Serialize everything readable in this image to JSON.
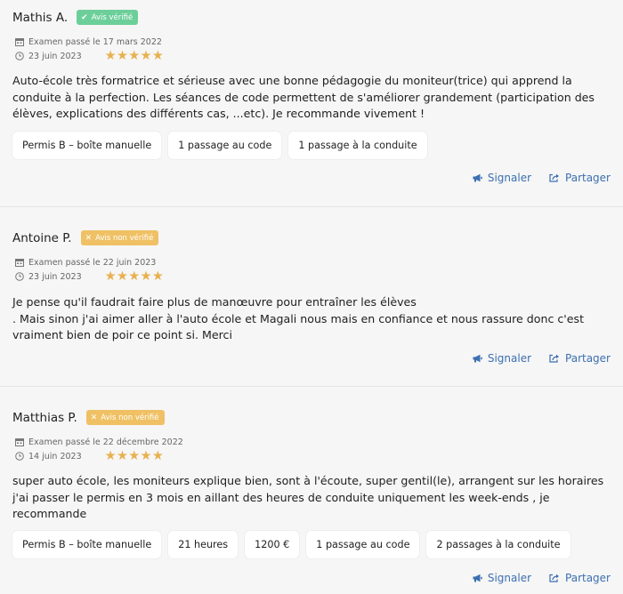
{
  "reviews": [
    {
      "name": "Mathis A.",
      "badge": "Avis vérifié",
      "badge_icon": "check-icon",
      "exam": "Examen passé le 17 mars 2022",
      "date": "23 juin 2023",
      "stars": "★★★★★",
      "rating": 5,
      "text": "Auto-école très formatrice et sérieuse avec une bonne pédagogie du moniteur(trice) qui apprend la conduite à la perfection. Les séances de code permettent de s'améliorer grandement (participation des élèves, explications des différents cas, ...etc). Je recommande vivement !",
      "chips": [
        "Permis B – boîte manuelle",
        "1 passage au code",
        "1 passage à la conduite"
      ],
      "report": "Signaler",
      "share": "Partager"
    },
    {
      "name": "Antoine P.",
      "badge": "Avis non vérifié",
      "badge_icon": "cross-icon",
      "exam": "Examen passé le 22 juin 2023",
      "date": "23 juin 2023",
      "stars": "★★★★★",
      "rating": 5,
      "text": "Je pense qu'il faudrait faire plus de manœuvre pour entraîner les élèves\n. Mais sinon j'ai aimer aller à l'auto école et Magali nous mais en confiance et nous rassure donc c'est vraiment bien de poir ce point si. Merci",
      "chips": [],
      "report": "Signaler",
      "share": "Partager"
    },
    {
      "name": "Matthias P.",
      "badge": "Avis non vérifié",
      "badge_icon": "cross-icon",
      "exam": "Examen passé le 22 décembre 2022",
      "date": "14 juin 2023",
      "stars": "★★★★★",
      "rating": 5,
      "text": "super auto école, les moniteurs explique bien, sont à l'écoute, super gentil(le), arrangent sur les horaires j'ai passer le permis en 3 mois en aillant des heures de conduite uniquement les week-ends , je recommande",
      "chips": [
        "Permis B – boîte manuelle",
        "21 heures",
        "1200 €",
        "1 passage au code",
        "2 passages à la conduite"
      ],
      "report": "Signaler",
      "share": "Partager"
    }
  ],
  "colors": {
    "verified": "#6ccf9a",
    "unverified": "#efc164",
    "stars": "#e8b14f",
    "link": "#3b6fb0"
  }
}
